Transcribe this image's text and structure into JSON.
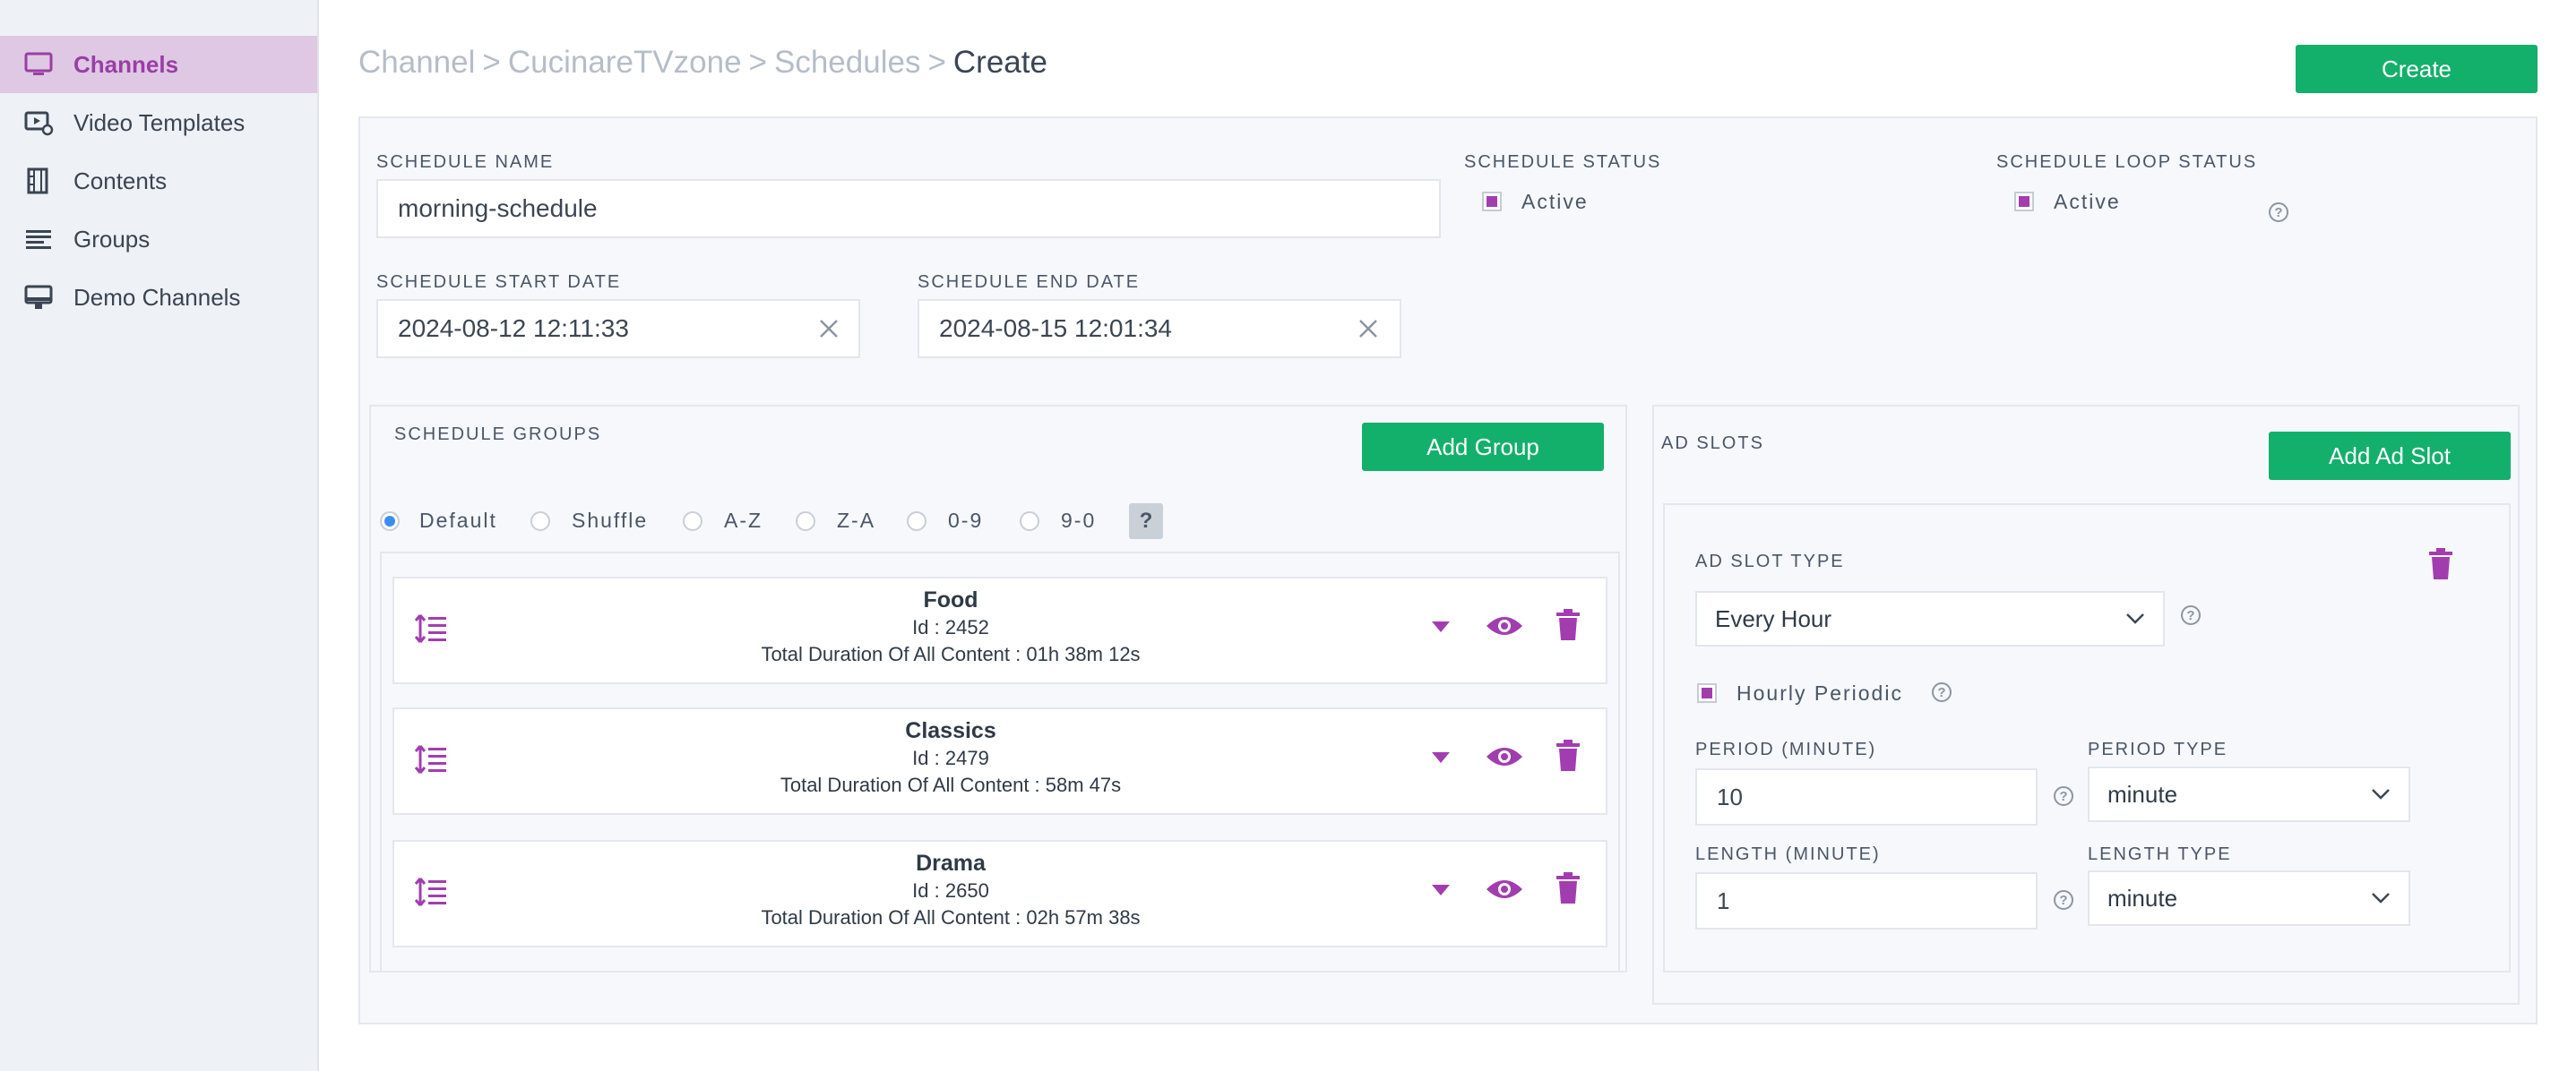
{
  "sidebar": {
    "items": [
      {
        "label": "Channels",
        "icon": "monitor-icon",
        "active": true
      },
      {
        "label": "Video Templates",
        "icon": "video-settings-icon",
        "active": false
      },
      {
        "label": "Contents",
        "icon": "film-icon",
        "active": false
      },
      {
        "label": "Groups",
        "icon": "list-icon",
        "active": false
      },
      {
        "label": "Demo Channels",
        "icon": "display-icon",
        "active": false
      }
    ]
  },
  "breadcrumb": {
    "items": [
      "Channel",
      "CucinareTVzone",
      "Schedules"
    ],
    "separator": ">",
    "current": "Create"
  },
  "header": {
    "create_label": "Create"
  },
  "form": {
    "schedule_name": {
      "label": "SCHEDULE NAME",
      "value": "morning-schedule"
    },
    "schedule_status": {
      "label": "SCHEDULE STATUS",
      "option": "Active",
      "checked": true
    },
    "schedule_loop_status": {
      "label": "SCHEDULE LOOP STATUS",
      "option": "Active",
      "checked": true
    },
    "start_date": {
      "label": "SCHEDULE START DATE",
      "value": "2024-08-12 12:11:33"
    },
    "end_date": {
      "label": "SCHEDULE END DATE",
      "value": "2024-08-15 12:01:34"
    }
  },
  "groups": {
    "title": "SCHEDULE GROUPS",
    "add_label": "Add Group",
    "sort_options": [
      "Default",
      "Shuffle",
      "A-Z",
      "Z-A",
      "0-9",
      "9-0"
    ],
    "selected_sort": "Default",
    "help_label": "?",
    "items": [
      {
        "name": "Food",
        "id_text": "Id : 2452",
        "duration_text": "Total Duration Of All Content : 01h 38m 12s"
      },
      {
        "name": "Classics",
        "id_text": "Id : 2479",
        "duration_text": "Total Duration Of All Content : 58m 47s"
      },
      {
        "name": "Drama",
        "id_text": "Id : 2650",
        "duration_text": "Total Duration Of All Content : 02h 57m 38s"
      }
    ]
  },
  "ad_slots": {
    "title": "AD SLOTS",
    "add_label": "Add Ad Slot",
    "slot": {
      "type_label": "AD SLOT TYPE",
      "type_value": "Every Hour",
      "hourly_periodic_label": "Hourly Periodic",
      "hourly_periodic_checked": true,
      "period_label": "PERIOD (MINUTE)",
      "period_value": "10",
      "period_type_label": "PERIOD TYPE",
      "period_type_value": "minute",
      "length_label": "LENGTH (MINUTE)",
      "length_value": "1",
      "length_type_label": "LENGTH TYPE",
      "length_type_value": "minute"
    }
  },
  "colors": {
    "accent": "#a23db0",
    "primary_button": "#13b06b",
    "sidebar_bg": "#eef1f5",
    "active_item_bg": "#dfc8e4",
    "radio_selected": "#3a8ef0"
  }
}
